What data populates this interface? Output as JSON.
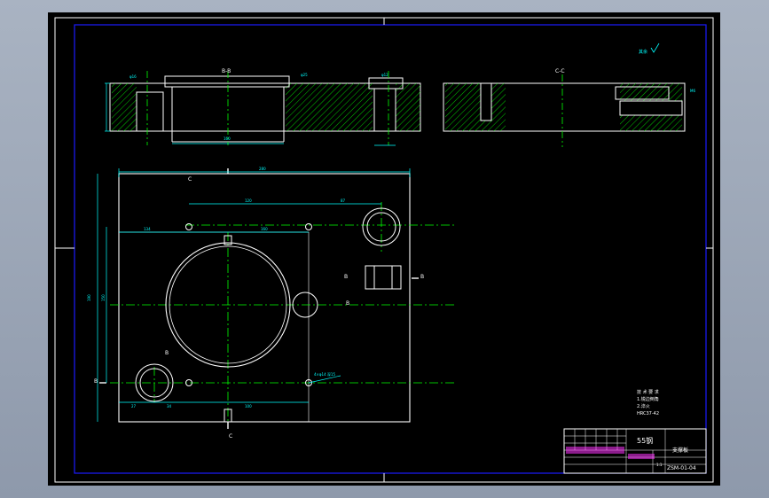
{
  "drawing": {
    "section_label_top": "B-B",
    "section_label_right": "C-C",
    "roughness_note": "其余",
    "cut_label_c": "C",
    "cut_label_b": "B",
    "dims": {
      "overall_width": "280",
      "hole_spacing": "120",
      "offset_87": "87",
      "left_134": "134",
      "center_160": "160",
      "height_190": "190",
      "height_150": "150",
      "bottom_27": "27",
      "bottom_34": "34",
      "bottom_100": "100",
      "hole_note": "4×φ14 深15",
      "top_dim_a": "φ16",
      "top_dim_b": "φ25",
      "top_dim_c": "φ12",
      "right_dim": "M6"
    },
    "tech_notes": {
      "title": "技 术 要 求",
      "line1": "1.锐边倒角",
      "line2": "2.淬火",
      "line3": "HRC37-42"
    }
  },
  "title_block": {
    "material": "55钢",
    "part_name": "支撑板",
    "drawing_number": "ZSM-01-04",
    "sheet_scale": "1:1"
  },
  "colors": {
    "background": "#000000",
    "outline": "#ffffff",
    "dimension": "#00ffff",
    "hatch": "#00ff00",
    "centerline": "#00ff00",
    "border": "#0000ff",
    "title_block": "#ff33ff"
  }
}
